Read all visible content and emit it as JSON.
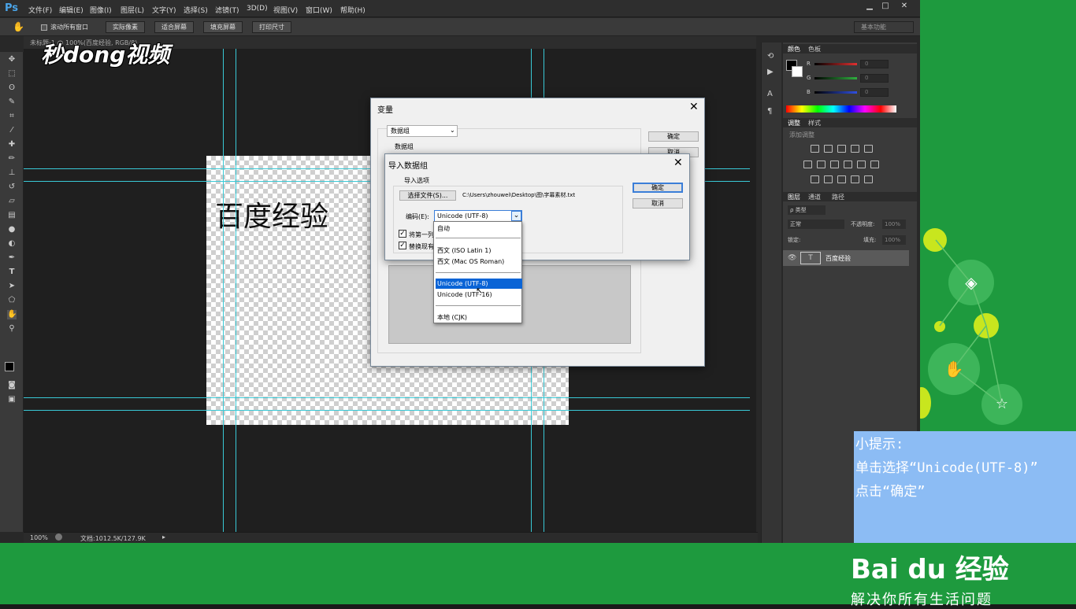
{
  "menubar": {
    "logo": "Ps",
    "items": [
      "文件(F)",
      "编辑(E)",
      "图像(I)",
      "图层(L)",
      "文字(Y)",
      "选择(S)",
      "滤镜(T)",
      "3D(D)",
      "视图(V)",
      "窗口(W)",
      "帮助(H)"
    ],
    "window_controls": [
      "▁",
      "□",
      "✕"
    ]
  },
  "options_bar": {
    "checkbox_label": "滚动所有窗口",
    "buttons": [
      "实际像素",
      "适合屏幕",
      "填充屏幕",
      "打印尺寸"
    ],
    "workspace": "基本功能"
  },
  "document": {
    "tab_title": "未标题-1 @ 100%(百度经验, RGB/8)",
    "canvas_text": "百度经验",
    "status_zoom": "100%",
    "status_doc": "文档:1012.5K/127.9K"
  },
  "watermark": "秒dong视频",
  "panels": {
    "color_tabs": [
      "颜色",
      "色板"
    ],
    "channels": [
      {
        "label": "R",
        "color": "#e03030"
      },
      {
        "label": "G",
        "color": "#30b040"
      },
      {
        "label": "B",
        "color": "#3050e0"
      }
    ],
    "channel_values": [
      "0",
      "0",
      "0"
    ],
    "adjust_tabs": [
      "调整",
      "样式"
    ],
    "adjust_title": "添加调整",
    "layers_tabs": [
      "图层",
      "通道",
      "路径"
    ],
    "layer_kind": "ρ 类型",
    "blend_mode": "正常",
    "opacity_label": "不透明度:",
    "opacity_value": "100%",
    "lock_label": "锁定:",
    "fill_label": "填充:",
    "fill_value": "100%",
    "layer_name": "百度经验"
  },
  "dialog_variables": {
    "title": "变量",
    "select_value": "数据组",
    "group_label": "数据组",
    "ok": "确定",
    "cancel": "取消"
  },
  "dialog_import": {
    "title": "导入数据组",
    "group_label": "导入选项",
    "choose_file": "选择文件(S)...",
    "file_path": "C:\\Users\\zhouwei\\Desktop\\图\\字幕素材.txt",
    "encoding_label": "编码(E):",
    "encoding_value": "Unicode (UTF-8)",
    "check1": "将第一列",
    "check2": "替换现有",
    "ok": "确定",
    "cancel": "取消"
  },
  "encoding_dropdown": {
    "options": [
      "自动",
      "西文 (ISO Latin 1)",
      "西文 (Mac OS Roman)",
      "Unicode (UTF-8)",
      "Unicode (UTF-16)",
      "本地 (CJK)"
    ],
    "selected": "Unicode (UTF-8)"
  },
  "tip": {
    "line1": "小提示:",
    "line2": "单击选择“Unicode(UTF-8)”",
    "line3": "点击“确定”"
  },
  "branding": {
    "logo": "Bai du 经验",
    "slogan": "解决你所有生活问题"
  }
}
